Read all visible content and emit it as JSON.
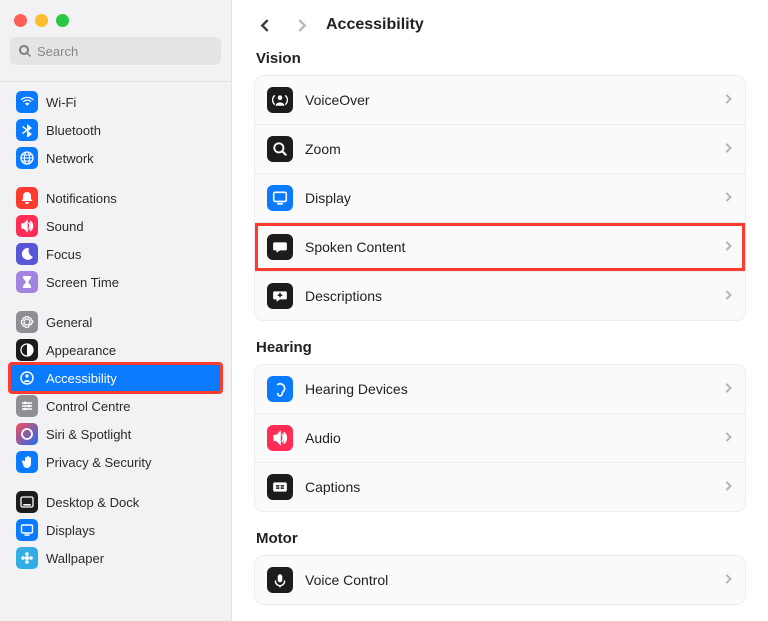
{
  "window": {
    "search_placeholder": "Search"
  },
  "sidebar": {
    "items": [
      {
        "label": "Wi-Fi",
        "name": "wifi",
        "bg": "bg-blue",
        "icon": "wifi"
      },
      {
        "label": "Bluetooth",
        "name": "bluetooth",
        "bg": "bg-blue",
        "icon": "bt"
      },
      {
        "label": "Network",
        "name": "network",
        "bg": "bg-blue",
        "icon": "globe"
      },
      {
        "label": "Notifications",
        "name": "notifications",
        "bg": "bg-red",
        "icon": "bell"
      },
      {
        "label": "Sound",
        "name": "sound",
        "bg": "bg-pink",
        "icon": "speaker"
      },
      {
        "label": "Focus",
        "name": "focus",
        "bg": "bg-purple",
        "icon": "moon"
      },
      {
        "label": "Screen Time",
        "name": "screentime",
        "bg": "bg-lavender",
        "icon": "hourglass"
      },
      {
        "label": "General",
        "name": "general",
        "bg": "bg-gray",
        "icon": "gear"
      },
      {
        "label": "Appearance",
        "name": "appearance",
        "bg": "bg-black",
        "icon": "half"
      },
      {
        "label": "Accessibility",
        "name": "accessibility",
        "bg": "bg-blue",
        "icon": "person",
        "selected": true,
        "highlighted": true
      },
      {
        "label": "Control Centre",
        "name": "controlcentre",
        "bg": "bg-gray",
        "icon": "sliders"
      },
      {
        "label": "Siri & Spotlight",
        "name": "siri",
        "bg": "bg-grad",
        "icon": "siri"
      },
      {
        "label": "Privacy & Security",
        "name": "privacy",
        "bg": "bg-blue",
        "icon": "hand"
      },
      {
        "label": "Desktop & Dock",
        "name": "desktop",
        "bg": "bg-black",
        "icon": "dock"
      },
      {
        "label": "Displays",
        "name": "displays",
        "bg": "bg-blue",
        "icon": "display"
      },
      {
        "label": "Wallpaper",
        "name": "wallpaper",
        "bg": "bg-cyan",
        "icon": "flower"
      }
    ],
    "groups": [
      [
        0,
        1,
        2
      ],
      [
        3,
        4,
        5,
        6
      ],
      [
        7,
        8,
        9,
        10,
        11,
        12
      ],
      [
        13,
        14,
        15
      ]
    ]
  },
  "header": {
    "title": "Accessibility"
  },
  "sections": [
    {
      "title": "Vision",
      "items": [
        {
          "label": "VoiceOver",
          "name": "voiceover",
          "bg": "bg-black",
          "icon": "vo"
        },
        {
          "label": "Zoom",
          "name": "zoom",
          "bg": "bg-black",
          "icon": "zoom"
        },
        {
          "label": "Display",
          "name": "display",
          "bg": "bg-blue",
          "icon": "display"
        },
        {
          "label": "Spoken Content",
          "name": "spoken-content",
          "bg": "bg-black",
          "icon": "bubble",
          "highlighted": true
        },
        {
          "label": "Descriptions",
          "name": "descriptions",
          "bg": "bg-black",
          "icon": "plusbubble"
        }
      ]
    },
    {
      "title": "Hearing",
      "items": [
        {
          "label": "Hearing Devices",
          "name": "hearing-devices",
          "bg": "bg-blue",
          "icon": "ear"
        },
        {
          "label": "Audio",
          "name": "audio",
          "bg": "bg-pink",
          "icon": "speaker"
        },
        {
          "label": "Captions",
          "name": "captions",
          "bg": "bg-black",
          "icon": "cc"
        }
      ]
    },
    {
      "title": "Motor",
      "items": [
        {
          "label": "Voice Control",
          "name": "voice-control",
          "bg": "bg-black",
          "icon": "mic"
        }
      ]
    }
  ]
}
